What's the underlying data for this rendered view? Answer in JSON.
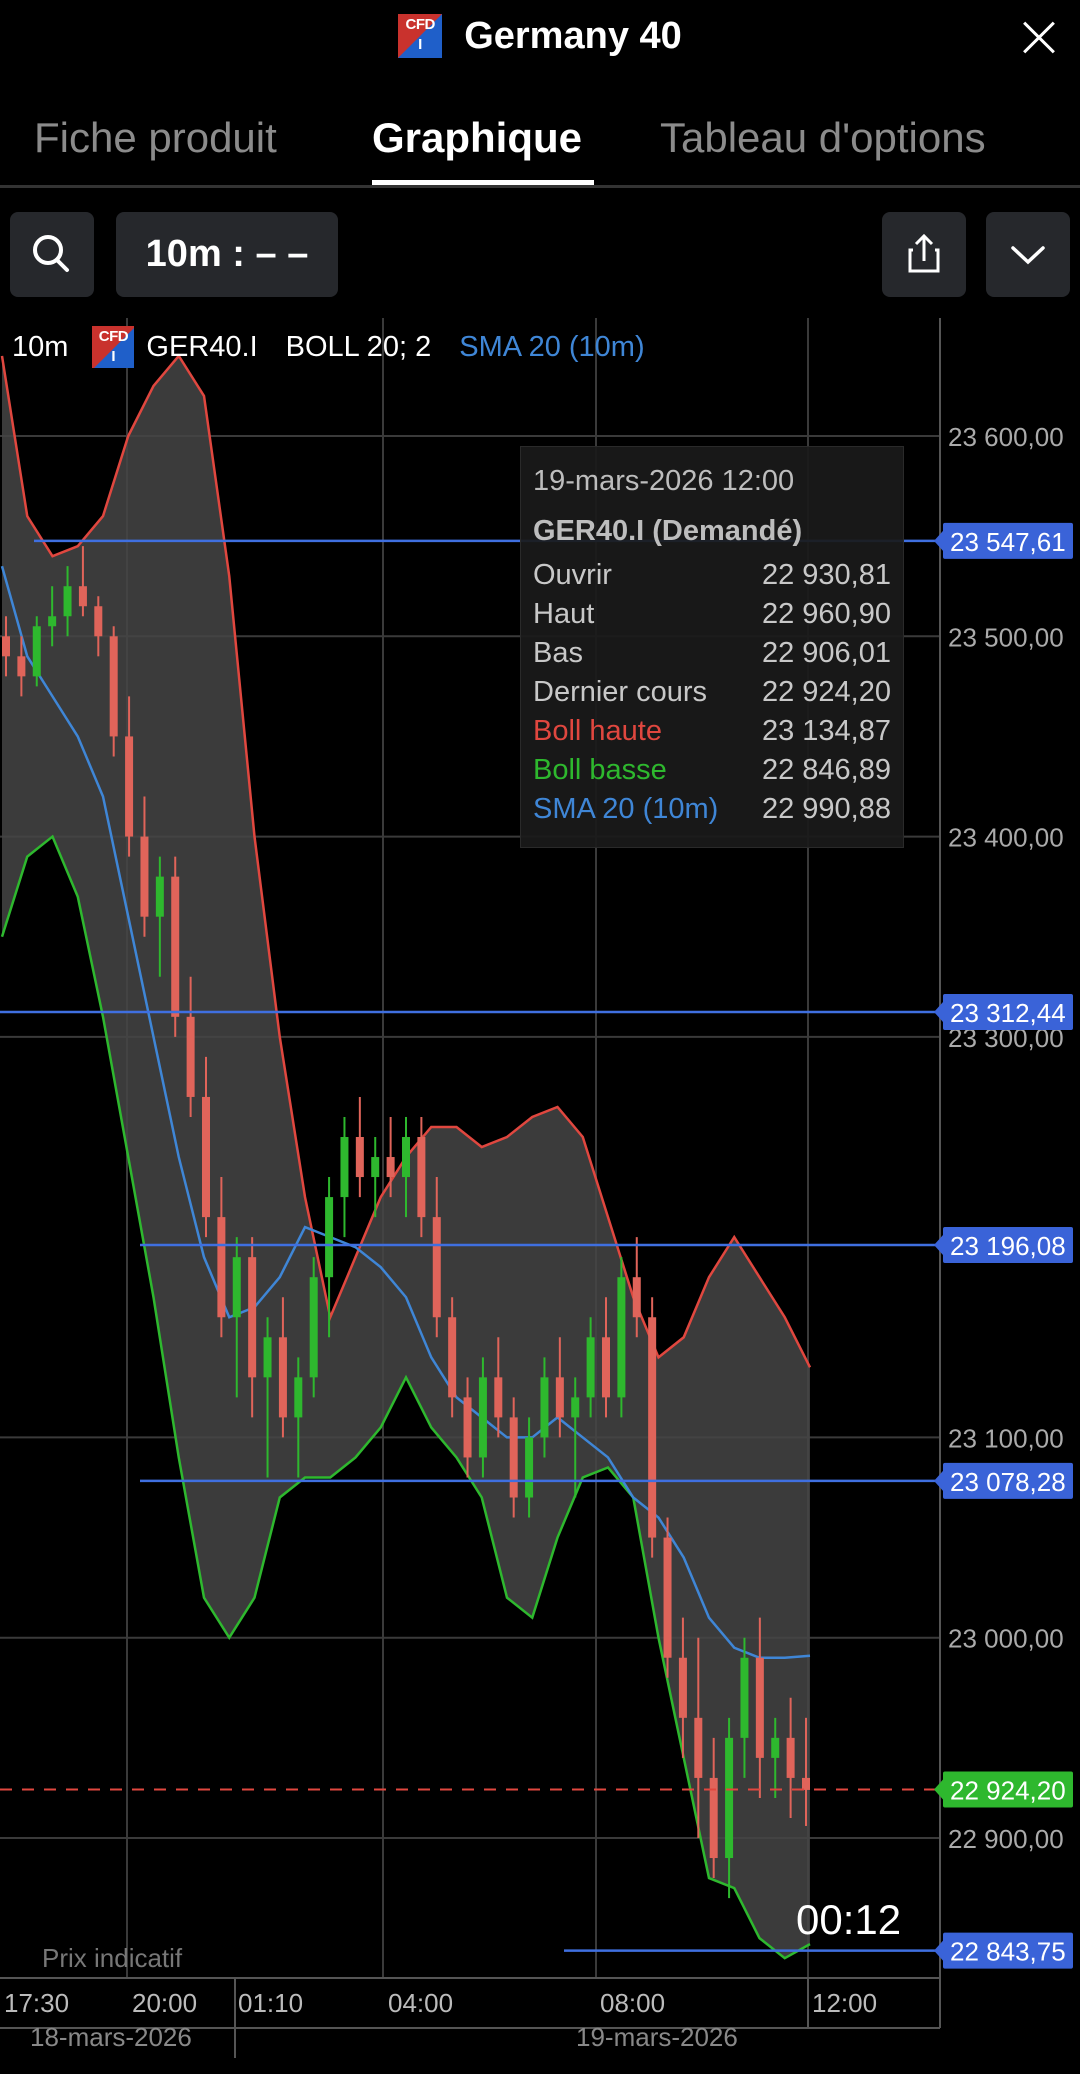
{
  "header": {
    "title": "Germany 40",
    "logo_text": "CFD",
    "logo_sub": "I"
  },
  "tabs": [
    {
      "label": "Fiche produit"
    },
    {
      "label": "Graphique"
    },
    {
      "label": "Tableau d'options"
    }
  ],
  "toolbar": {
    "interval_label": "10m : – –"
  },
  "legend": {
    "interval": "10m",
    "symbol": "GER40.I",
    "boll": "BOLL 20; 2",
    "sma": "SMA 20 (10m)"
  },
  "tooltip": {
    "date": "19-mars-2026 12:00",
    "symbol": "GER40.I (Demandé)",
    "rows": [
      {
        "label": "Ouvrir",
        "value": "22 930,81"
      },
      {
        "label": "Haut",
        "value": "22 960,90"
      },
      {
        "label": "Bas",
        "value": "22 906,01"
      },
      {
        "label": "Dernier cours",
        "value": "22 924,20"
      },
      {
        "label": "Boll haute",
        "value": "23 134,87"
      },
      {
        "label": "Boll basse",
        "value": "22 846,89"
      },
      {
        "label": "SMA 20 (10m)",
        "value": "22 990,88"
      }
    ]
  },
  "countdown": "00:12",
  "indicatif_label": "Prix indicatif",
  "colors": {
    "up": "#2eb82e",
    "down": "#e0645a",
    "boll_upper": "#e0473f",
    "boll_lower": "#2eb82e",
    "sma": "#3f86d6",
    "hline": "#3f6fe0",
    "band_fill": "#454545",
    "grid": "#3a3a3a"
  },
  "chart_data": {
    "type": "candlestick",
    "symbol": "GER40.I",
    "ylim": [
      22820,
      23680
    ],
    "y_ticks": [
      {
        "value": 23600,
        "label": "23 600,00"
      },
      {
        "value": 23500,
        "label": "23 500,00"
      },
      {
        "value": 23400,
        "label": "23 400,00"
      },
      {
        "value": 23300,
        "label": "23 300,00"
      },
      {
        "value": 23100,
        "label": "23 100,00"
      },
      {
        "value": 23000,
        "label": "23 000,00"
      },
      {
        "value": 22900,
        "label": "22 900,00"
      }
    ],
    "x_ticks": [
      "17:30",
      "20:00",
      "01:10",
      "04:00",
      "08:00",
      "12:00"
    ],
    "date_labels": [
      "18-mars-2026",
      "19-mars-2026"
    ],
    "horizontal_levels": [
      {
        "value": 23547.61,
        "label": "23 547,61"
      },
      {
        "value": 23312.44,
        "label": "23 312,44"
      },
      {
        "value": 23196.08,
        "label": "23 196,08"
      },
      {
        "value": 23078.28,
        "label": "23 078,28"
      },
      {
        "value": 22843.75,
        "label": "22 843,75"
      }
    ],
    "last_price": {
      "value": 22924.2,
      "label": "22 924,20"
    },
    "boll_upper": [
      23640,
      23560,
      23540,
      23545,
      23560,
      23600,
      23625,
      23640,
      23620,
      23530,
      23400,
      23300,
      23220,
      23160,
      23190,
      23220,
      23240,
      23255,
      23255,
      23245,
      23250,
      23260,
      23265,
      23250,
      23210,
      23170,
      23140,
      23150,
      23180,
      23200,
      23180,
      23160,
      23135
    ],
    "boll_lower": [
      23350,
      23390,
      23400,
      23370,
      23310,
      23240,
      23170,
      23090,
      23020,
      23000,
      23020,
      23070,
      23080,
      23080,
      23090,
      23105,
      23130,
      23105,
      23090,
      23070,
      23020,
      23010,
      23050,
      23080,
      23085,
      23070,
      23000,
      22940,
      22880,
      22875,
      22850,
      22840,
      22847
    ],
    "sma": [
      23535,
      23490,
      23470,
      23450,
      23420,
      23360,
      23300,
      23240,
      23190,
      23160,
      23165,
      23180,
      23205,
      23200,
      23195,
      23185,
      23170,
      23140,
      23120,
      23110,
      23100,
      23100,
      23110,
      23100,
      23090,
      23070,
      23060,
      23040,
      23010,
      22995,
      22990,
      22990,
      22991
    ],
    "candles": [
      [
        23500,
        23510,
        23480,
        23490
      ],
      [
        23490,
        23500,
        23470,
        23480
      ],
      [
        23480,
        23510,
        23475,
        23505
      ],
      [
        23505,
        23525,
        23495,
        23510
      ],
      [
        23510,
        23535,
        23500,
        23525
      ],
      [
        23525,
        23545,
        23510,
        23515
      ],
      [
        23515,
        23520,
        23490,
        23500
      ],
      [
        23500,
        23505,
        23440,
        23450
      ],
      [
        23450,
        23470,
        23390,
        23400
      ],
      [
        23400,
        23420,
        23350,
        23360
      ],
      [
        23360,
        23390,
        23330,
        23380
      ],
      [
        23380,
        23390,
        23300,
        23310
      ],
      [
        23310,
        23330,
        23260,
        23270
      ],
      [
        23270,
        23290,
        23200,
        23210
      ],
      [
        23210,
        23230,
        23150,
        23160
      ],
      [
        23160,
        23200,
        23120,
        23190
      ],
      [
        23190,
        23200,
        23110,
        23130
      ],
      [
        23130,
        23160,
        23080,
        23150
      ],
      [
        23150,
        23170,
        23100,
        23110
      ],
      [
        23110,
        23140,
        23080,
        23130
      ],
      [
        23130,
        23190,
        23120,
        23180
      ],
      [
        23180,
        23230,
        23150,
        23220
      ],
      [
        23220,
        23260,
        23200,
        23250
      ],
      [
        23250,
        23270,
        23220,
        23230
      ],
      [
        23230,
        23250,
        23210,
        23240
      ],
      [
        23240,
        23260,
        23220,
        23230
      ],
      [
        23230,
        23260,
        23210,
        23250
      ],
      [
        23250,
        23260,
        23200,
        23210
      ],
      [
        23210,
        23230,
        23150,
        23160
      ],
      [
        23160,
        23170,
        23110,
        23120
      ],
      [
        23120,
        23130,
        23080,
        23090
      ],
      [
        23090,
        23140,
        23080,
        23130
      ],
      [
        23130,
        23150,
        23100,
        23110
      ],
      [
        23110,
        23120,
        23060,
        23070
      ],
      [
        23070,
        23110,
        23060,
        23100
      ],
      [
        23100,
        23140,
        23090,
        23130
      ],
      [
        23130,
        23150,
        23100,
        23110
      ],
      [
        23110,
        23130,
        23070,
        23120
      ],
      [
        23120,
        23160,
        23110,
        23150
      ],
      [
        23150,
        23170,
        23110,
        23120
      ],
      [
        23120,
        23190,
        23110,
        23180
      ],
      [
        23180,
        23200,
        23150,
        23160
      ],
      [
        23160,
        23170,
        23040,
        23050
      ],
      [
        23050,
        23060,
        22980,
        22990
      ],
      [
        22990,
        23010,
        22940,
        22960
      ],
      [
        22960,
        23000,
        22900,
        22930
      ],
      [
        22930,
        22950,
        22880,
        22890
      ],
      [
        22890,
        22960,
        22870,
        22950
      ],
      [
        22950,
        23000,
        22930,
        22990
      ],
      [
        22990,
        23010,
        22920,
        22940
      ],
      [
        22940,
        22960,
        22920,
        22950
      ],
      [
        22950,
        22970,
        22910,
        22930
      ],
      [
        22930,
        22960,
        22906,
        22924
      ]
    ]
  }
}
